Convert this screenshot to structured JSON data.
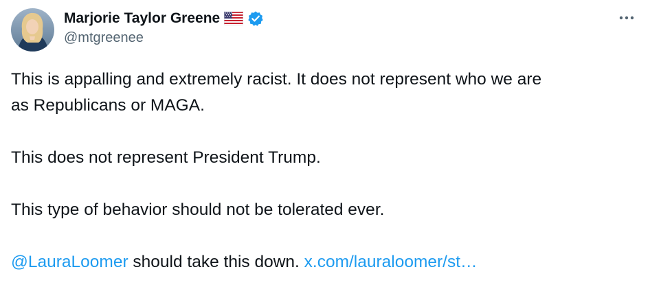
{
  "author": {
    "display_name": "Marjorie Taylor Greene",
    "handle": "@mtgreenee",
    "flag_icon": "us-flag-icon",
    "verified_icon": "verified-badge-icon"
  },
  "menu": {
    "icon": "more-options-icon"
  },
  "tweet": {
    "line1": "This is appalling and extremely racist.  It does not represent who we are",
    "line2": "as Republicans or MAGA.",
    "line3": "This does not represent President Trump.",
    "line4": "This type of behavior should not be tolerated ever.",
    "mention": "@LauraLoomer",
    "line5_middle": " should take this down. ",
    "url": "x.com/lauraloomer/st…"
  },
  "colors": {
    "text": "#0f1419",
    "secondary": "#536471",
    "link": "#1d9bf0",
    "verified": "#1d9bf0"
  }
}
